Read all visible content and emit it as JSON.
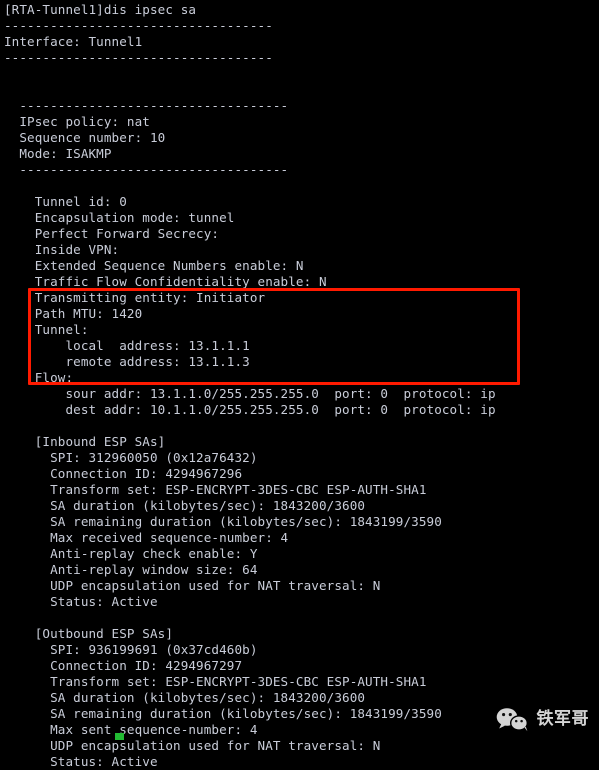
{
  "terminal": {
    "prompt_line": "[RTA-Tunnel1]dis ipsec sa",
    "lines": [
      "[RTA-Tunnel1]dis ipsec sa",
      "===================================",
      "Interface: Tunnel1",
      "===================================",
      "",
      "",
      "  ===================================",
      "  IPsec policy: nat",
      "  Sequence number: 10",
      "  Mode: ISAKMP",
      "  ===================================",
      "",
      "    Tunnel id: 0",
      "    Encapsulation mode: tunnel",
      "    Perfect Forward Secrecy:",
      "    Inside VPN:",
      "    Extended Sequence Numbers enable: N",
      "    Traffic Flow Confidentiality enable: N",
      "    Transmitting entity: Initiator",
      "    Path MTU: 1420",
      "    Tunnel:",
      "        local  address: 13.1.1.1",
      "        remote address: 13.1.1.3",
      "    Flow:",
      "        sour addr: 13.1.1.0/255.255.255.0  port: 0  protocol: ip",
      "        dest addr: 10.1.1.0/255.255.255.0  port: 0  protocol: ip",
      "",
      "    [Inbound ESP SAs]",
      "      SPI: 312960050 (0x12a76432)",
      "      Connection ID: 4294967296",
      "      Transform set: ESP-ENCRYPT-3DES-CBC ESP-AUTH-SHA1",
      "      SA duration (kilobytes/sec): 1843200/3600",
      "      SA remaining duration (kilobytes/sec): 1843199/3590",
      "      Max received sequence-number: 4",
      "      Anti-replay check enable: Y",
      "      Anti-replay window size: 64",
      "      UDP encapsulation used for NAT traversal: N",
      "      Status: Active",
      "",
      "    [Outbound ESP SAs]",
      "      SPI: 936199691 (0x37cd460b)",
      "      Connection ID: 4294967297",
      "      Transform set: ESP-ENCRYPT-3DES-CBC ESP-AUTH-SHA1",
      "      SA duration (kilobytes/sec): 1843200/3600",
      "      SA remaining duration (kilobytes/sec): 1843199/3590",
      "      Max sent sequence-number: 4",
      "      UDP encapsulation used for NAT traversal: N",
      "      Status: Active"
    ],
    "separator_char": "-",
    "separator_full_length": 35,
    "separator_indented_length": 35,
    "text_color": "#c9cdd9",
    "background_color": "#000000"
  },
  "annotation": {
    "highlight_box_color": "#ff1a00",
    "highlight_box_label": "tunnel-and-flow-highlight"
  },
  "cursor": {
    "color": "#22bb33",
    "visible": true
  },
  "watermark": {
    "text": "铁军哥",
    "icon": "wechat-icon",
    "icon_color": "#e8e8e8"
  }
}
